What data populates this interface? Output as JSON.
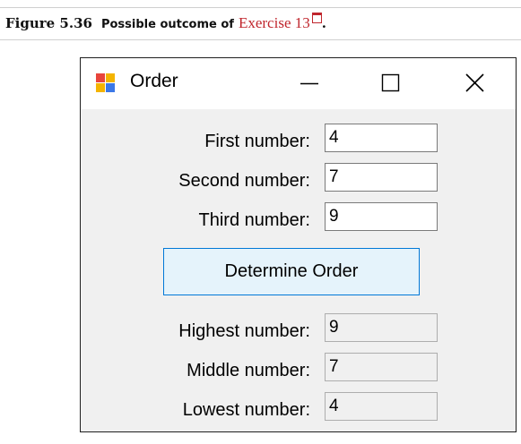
{
  "caption": {
    "figure_label": "Figure 5.36",
    "description": "Possible outcome of",
    "link_text": "Exercise 13",
    "period": "."
  },
  "window": {
    "title": "Order",
    "icons": {
      "app": "form-app-icon",
      "minimize": "minimize-icon",
      "maximize": "maximize-icon",
      "close": "close-icon"
    }
  },
  "inputs": [
    {
      "label": "First number:",
      "value": "4"
    },
    {
      "label": "Second number:",
      "value": "7"
    },
    {
      "label": "Third number:",
      "value": "9"
    }
  ],
  "button": {
    "label": "Determine Order"
  },
  "outputs": [
    {
      "label": "Highest number:",
      "value": "9"
    },
    {
      "label": "Middle number:",
      "value": "7"
    },
    {
      "label": "Lowest number:",
      "value": "4"
    }
  ],
  "colors": {
    "link": "#c0262d",
    "button_border": "#0078d7",
    "button_fill": "#e5f3fb",
    "form_background": "#f0f0f0"
  }
}
